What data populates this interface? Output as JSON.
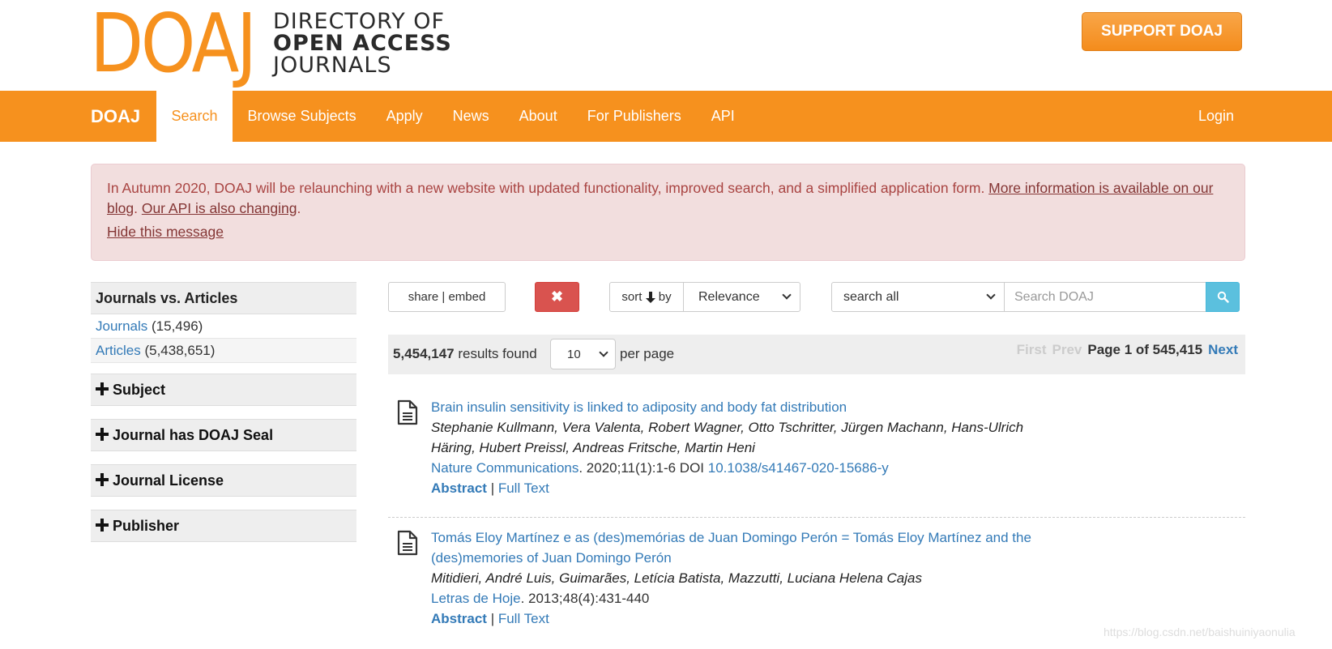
{
  "header": {
    "logo_mark": "DOAJ",
    "logo_lines": [
      "DIRECTORY OF",
      "OPEN ACCESS",
      "JOURNALS"
    ],
    "support_label": "SUPPORT DOAJ"
  },
  "nav": {
    "brand": "DOAJ",
    "items": [
      {
        "label": "Search",
        "active": true
      },
      {
        "label": "Browse Subjects"
      },
      {
        "label": "Apply"
      },
      {
        "label": "News"
      },
      {
        "label": "About"
      },
      {
        "label": "For Publishers"
      },
      {
        "label": "API"
      }
    ],
    "login": "Login"
  },
  "alert": {
    "text": "In Autumn 2020, DOAJ will be relaunching with a new website with updated functionality, improved search, and a simplified application form. ",
    "link1": "More information is available on our blog",
    "sep": ". ",
    "link2": "Our API is also changing",
    "end": ".",
    "hide": "Hide this message"
  },
  "facets": {
    "type_heading": "Journals vs. Articles",
    "types": [
      {
        "label": "Journals",
        "count": "(15,496)"
      },
      {
        "label": "Articles",
        "count": "(5,438,651)"
      }
    ],
    "toggles": [
      "Subject",
      "Journal has DOAJ Seal",
      "Journal License",
      "Publisher"
    ]
  },
  "toolbar": {
    "share": "share | embed",
    "clear": "✖",
    "sort_prefix": "sort",
    "sort_arrow": "🡣",
    "sort_suffix": "by",
    "sort_value": "Relevance",
    "search_field": "search all",
    "search_placeholder": "Search DOAJ"
  },
  "results_bar": {
    "count": "5,454,147",
    "found": " results found",
    "per_page_value": "10",
    "per_page_label": "per page",
    "first": "First",
    "prev": "Prev",
    "page": "Page 1 of 545,415",
    "next": "Next"
  },
  "results": [
    {
      "title": "Brain insulin sensitivity is linked to adiposity and body fat distribution",
      "authors": "Stephanie Kullmann, Vera Valenta, Robert Wagner, Otto Tschritter, Jürgen Machann, Hans-Ulrich Häring, Hubert Preissl, Andreas Fritsche, Martin Heni",
      "journal": "Nature Communications",
      "citation": ". 2020;11(1):1-6 DOI ",
      "doi": "10.1038/s41467-020-15686-y",
      "abstract": "Abstract",
      "sep": " | ",
      "fulltext": "Full Text"
    },
    {
      "title": "Tomás Eloy Martínez e as (des)memórias de Juan Domingo Perón = Tomás Eloy Martínez and the (des)memories of Juan Domingo Perón",
      "authors": "Mitidieri, André Luis, Guimarães, Letícia Batista, Mazzutti, Luciana Helena Cajas",
      "journal": "Letras de Hoje",
      "citation": ". 2013;48(4):431-440",
      "doi": "",
      "abstract": "Abstract",
      "sep": " | ",
      "fulltext": "Full Text"
    }
  ],
  "watermark": "https://blog.csdn.net/baishuiniyaonulia",
  "colors": {
    "accent": "#f6911e",
    "link": "#337ab7",
    "alert_bg": "#f2dede",
    "danger": "#d9534f",
    "info": "#5bc0de"
  }
}
